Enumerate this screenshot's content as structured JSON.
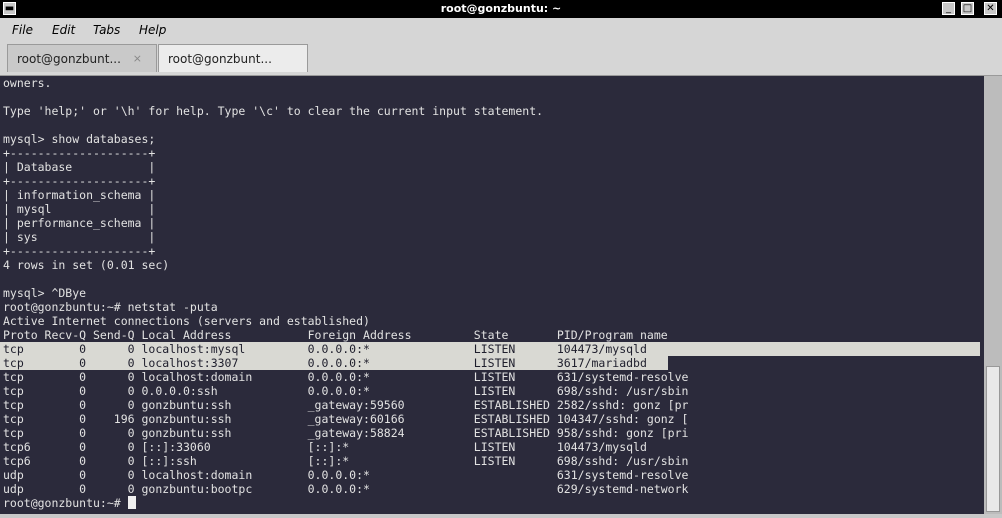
{
  "window": {
    "title": "root@gonzbuntu: ~"
  },
  "menu": [
    "File",
    "Edit",
    "Tabs",
    "Help"
  ],
  "tabs": [
    {
      "label": "root@gonzbunt...",
      "active": false
    },
    {
      "label": "root@gonzbunt...",
      "active": true
    }
  ],
  "terminal": {
    "lines": [
      "owners.",
      "",
      "Type 'help;' or '\\h' for help. Type '\\c' to clear the current input statement.",
      "",
      "mysql> show databases;",
      "+--------------------+",
      "| Database           |",
      "+--------------------+",
      "| information_schema |",
      "| mysql              |",
      "| performance_schema |",
      "| sys                |",
      "+--------------------+",
      "4 rows in set (0.01 sec)",
      "",
      "mysql> ^DBye",
      "root@gonzbuntu:~# netstat -puta",
      "Active Internet connections (servers and established)",
      "Proto Recv-Q Send-Q Local Address           Foreign Address         State       PID/Program name",
      "tcp        0      0 localhost:mysql         0.0.0.0:*               LISTEN      104473/mysqld",
      "tcp        0      0 localhost:3307          0.0.0.0:*               LISTEN      3617/mariadbd",
      "tcp        0      0 localhost:domain        0.0.0.0:*               LISTEN      631/systemd-resolve",
      "tcp        0      0 0.0.0.0:ssh             0.0.0.0:*               LISTEN      698/sshd: /usr/sbin",
      "tcp        0      0 gonzbuntu:ssh           _gateway:59560          ESTABLISHED 2582/sshd: gonz [pr",
      "tcp        0    196 gonzbuntu:ssh           _gateway:60166          ESTABLISHED 104347/sshd: gonz [",
      "tcp        0      0 gonzbuntu:ssh           _gateway:58824          ESTABLISHED 958/sshd: gonz [pri",
      "tcp6       0      0 [::]:33060              [::]:*                  LISTEN      104473/mysqld",
      "tcp6       0      0 [::]:ssh                [::]:*                  LISTEN      698/sshd: /usr/sbin",
      "udp        0      0 localhost:domain        0.0.0.0:*                           631/systemd-resolve",
      "udp        0      0 gonzbuntu:bootpc        0.0.0.0:*                           629/systemd-network"
    ],
    "prompt": "root@gonzbuntu:~# "
  },
  "icons": {
    "window_menu": "window-menu-icon",
    "minimize": "minimize-icon",
    "maximize": "maximize-icon",
    "close": "close-icon",
    "tab_close": "tab-close-icon"
  },
  "colors": {
    "terminal_bg": "#2b2a3b",
    "terminal_fg": "#e2e2e2",
    "selection_bg": "#d9d9d3"
  }
}
